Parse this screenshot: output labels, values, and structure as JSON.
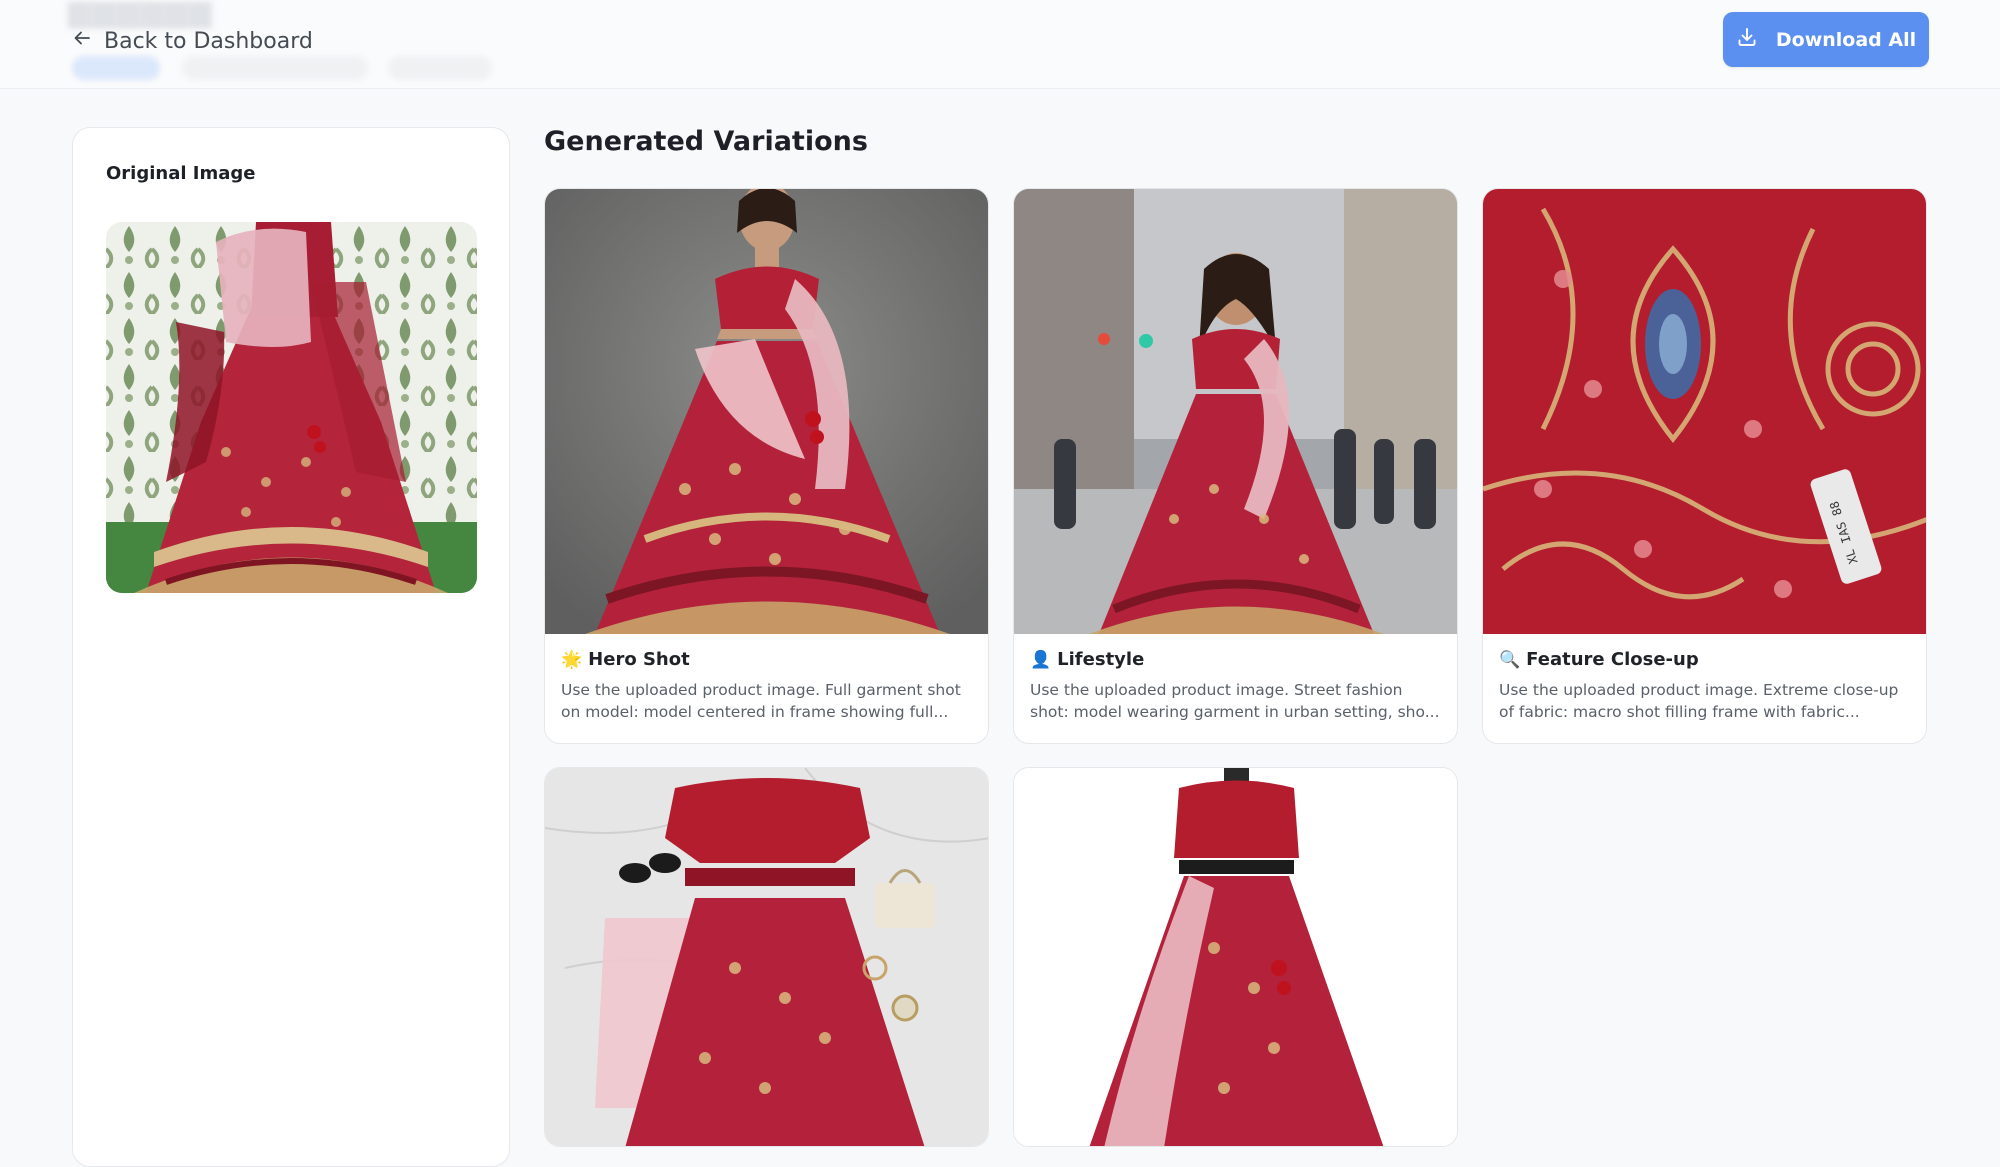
{
  "header": {
    "back_label": "Back to Dashboard",
    "download_label": "Download All"
  },
  "left": {
    "title": "Original Image"
  },
  "main": {
    "title": "Generated Variations",
    "variations": [
      {
        "icon": "sparkle-icon",
        "emoji": "🌟",
        "title": "Hero Shot",
        "description": "Use the uploaded product image. Full garment shot on model: model centered in frame showing full..."
      },
      {
        "icon": "person-icon",
        "emoji": "👤",
        "title": "Lifestyle",
        "description": "Use the uploaded product image. Street fashion shot: model wearing garment in urban setting, sho..."
      },
      {
        "icon": "magnifier-icon",
        "emoji": "🔍",
        "title": "Feature Close-up",
        "description": "Use the uploaded product image. Extreme close-up of fabric: macro shot filling frame with fabric..."
      },
      {
        "title": "",
        "description": ""
      },
      {
        "title": "",
        "description": ""
      }
    ]
  },
  "colors": {
    "accent": "#5b8ff0",
    "garment_red": "#b21d33",
    "background": "#f8f9fa"
  }
}
